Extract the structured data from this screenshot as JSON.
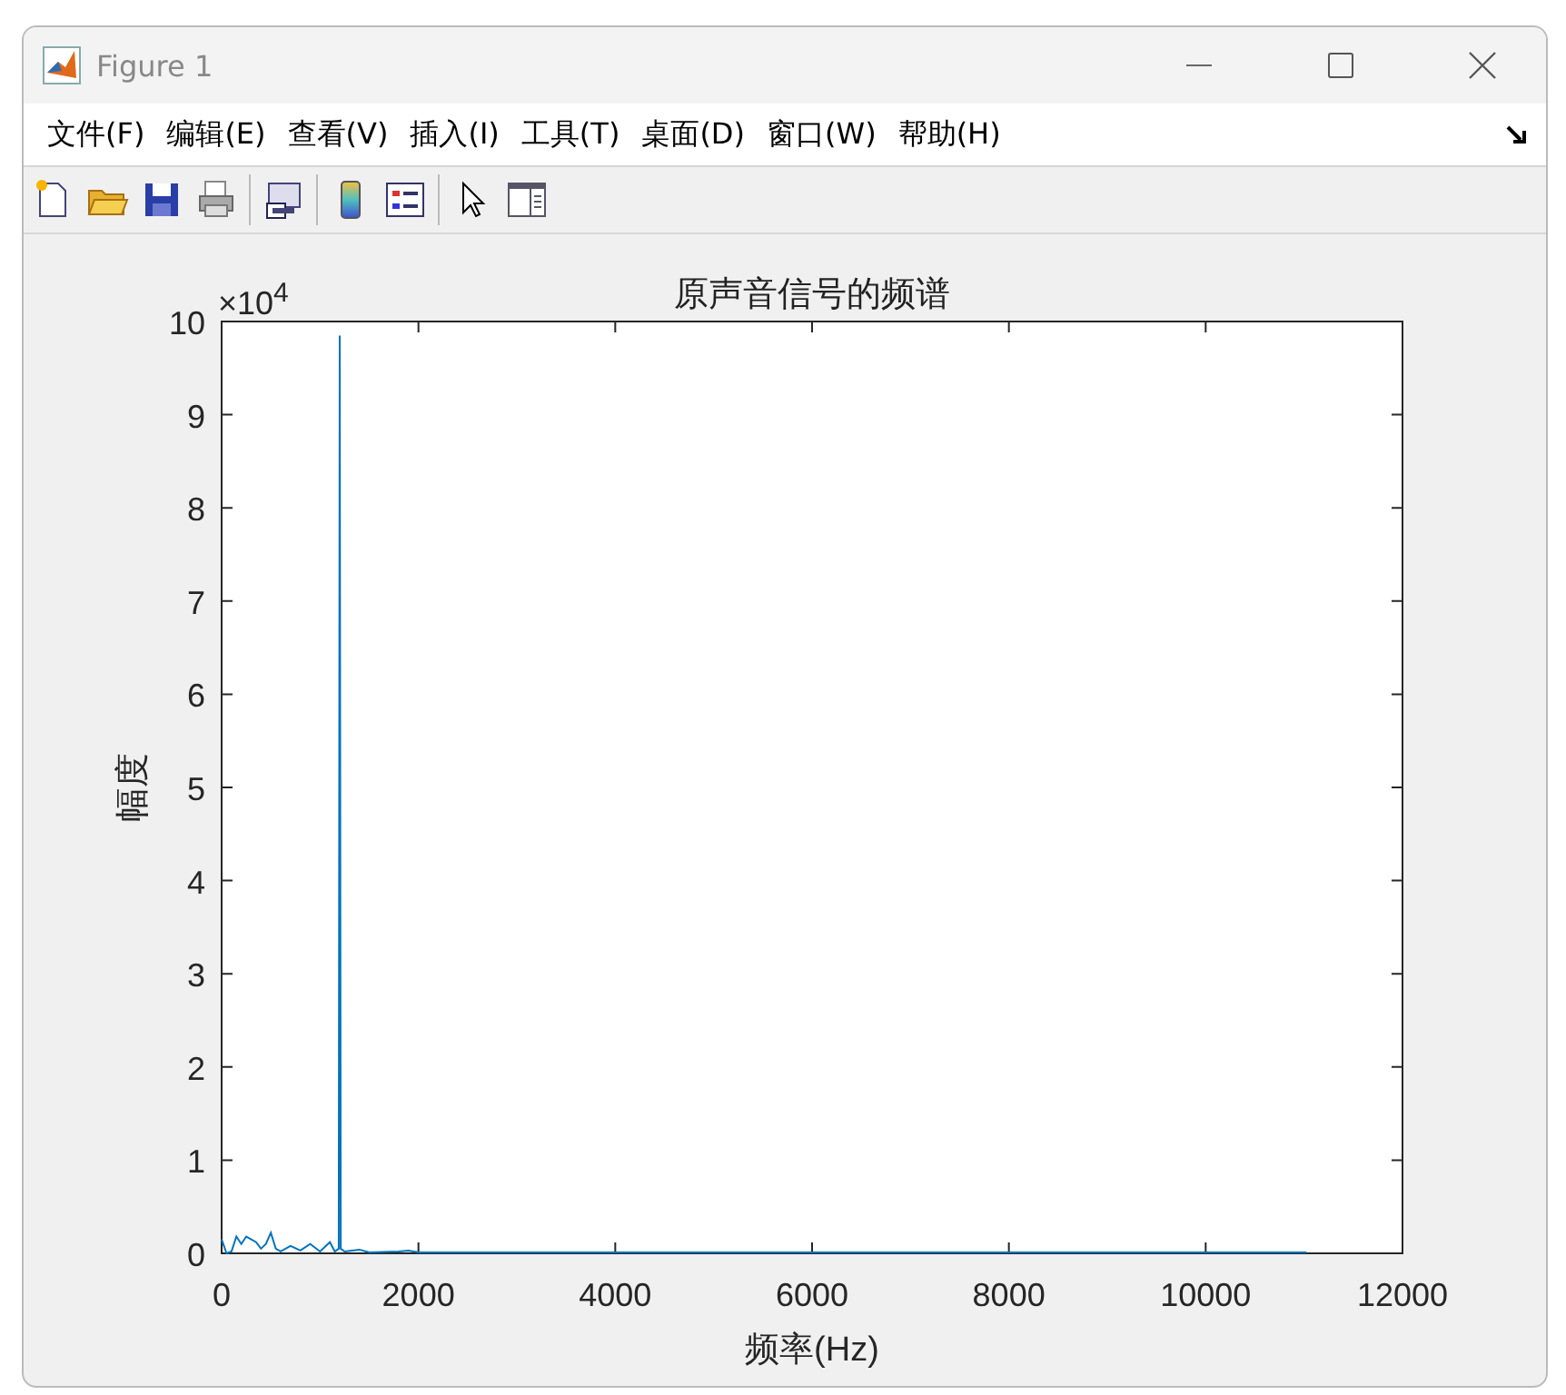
{
  "window": {
    "title": "Figure 1"
  },
  "menu": [
    {
      "label": "文件(F)"
    },
    {
      "label": "编辑(E)"
    },
    {
      "label": "查看(V)"
    },
    {
      "label": "插入(I)"
    },
    {
      "label": "工具(T)"
    },
    {
      "label": "桌面(D)"
    },
    {
      "label": "窗口(W)"
    },
    {
      "label": "帮助(H)"
    }
  ],
  "axes": {
    "exponent_label": "×10$^{4}$",
    "chart_data": {
      "type": "line",
      "title": "原声音信号的频谱",
      "xlabel": "频率(Hz)",
      "ylabel": "幅度",
      "x": [
        0,
        50,
        100,
        150,
        200,
        250,
        300,
        350,
        400,
        450,
        500,
        550,
        600,
        700,
        800,
        900,
        1000,
        1100,
        1150,
        1190,
        1200,
        1210,
        1250,
        1400,
        1500,
        1800,
        1900,
        2000,
        3000,
        4000,
        5000,
        6000,
        7000,
        8000,
        9000,
        10000,
        11025
      ],
      "series": [
        {
          "color": "#0072bd",
          "values": [
            0.15,
            0,
            0.02,
            0.18,
            0.1,
            0.18,
            0.15,
            0.12,
            0.05,
            0.1,
            0.22,
            0.05,
            0.02,
            0.08,
            0.03,
            0.1,
            0.02,
            0.12,
            0.02,
            0.05,
            9.85,
            0.05,
            0.02,
            0.04,
            0.01,
            0.02,
            0.03,
            0.01,
            0.01,
            0.01,
            0.01,
            0.01,
            0.01,
            0.01,
            0.01,
            0.01,
            0.01
          ]
        }
      ],
      "xlim": [
        0,
        12000
      ],
      "ylim": [
        0,
        10
      ],
      "xticks": [
        0,
        2000,
        4000,
        6000,
        8000,
        10000,
        12000
      ],
      "yticks": [
        0,
        1,
        2,
        3,
        4,
        5,
        6,
        7,
        8,
        9,
        10
      ]
    }
  }
}
